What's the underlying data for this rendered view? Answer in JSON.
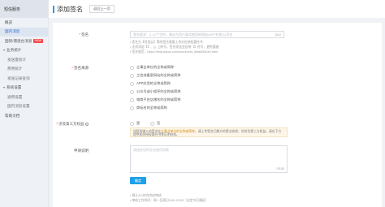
{
  "sidebar": {
    "brand": "短信服务",
    "items": [
      {
        "label": "概览",
        "type": "item"
      },
      {
        "label": "国内消息",
        "type": "item",
        "active": true
      },
      {
        "label": "国际/港澳台消息",
        "type": "item",
        "badge": "NEW"
      },
      {
        "label": "业务统计",
        "type": "group"
      },
      {
        "label": "发送量统计",
        "type": "sub"
      },
      {
        "label": "费用统计",
        "type": "sub"
      },
      {
        "label": "发送记录查询",
        "type": "sub"
      },
      {
        "label": "系统设置",
        "type": "group"
      },
      {
        "label": "通用设置",
        "type": "sub"
      },
      {
        "label": "国内消息设置",
        "type": "sub"
      },
      {
        "label": "帮助文档",
        "type": "item"
      }
    ]
  },
  "header": {
    "title": "添加签名",
    "back_label": "返回上一页"
  },
  "form": {
    "signature": {
      "label": "签名",
      "placeholder": "签名要求：2-12个字符，建议为用户真实使用的网站/APP名称/公司名",
      "counter": "0/12"
    },
    "signature_hints": [
      "• 签名为【阿里云】等的签名需要上传对应授权委托书",
      "• 无须添加【】、()、[]符号，签名发送会自带【】符号，避免重复",
      "• 签名规范：https://help.aliyun.com/document_detail/55040.html"
    ],
    "source": {
      "label": "签名来源",
      "options": [
        "企事业单位的全称或简称",
        "工信部备案网站的全称或简称",
        "APP应用的全称或简称",
        "公众号或小程序的全称或简称",
        "电商平台店铺名的全称或简称",
        "商标名的全称或简称"
      ]
    },
    "third_party": {
      "label": "涉及第三方权益",
      "options": [
        "是",
        "否"
      ]
    },
    "notice": {
      "text_1": "如您所输入的签名在",
      "highlight": "企事业单位的全称或简称",
      "text_2": "，请上传签名归属方的营业执照；如涉及第三方权益，请在下方提供",
      "text_3": "相关授权委托书等证明材料。"
    },
    "application": {
      "label": "申请说明",
      "placeholder": "请描述您的业务使用场景",
      "counter": "0/100"
    },
    "submit_label": "确定",
    "footer_notes": [
      "• 预计2小时内完成审核",
      "• 审核工作时间：周一至周日9:00-23:00（法定节日顺延）"
    ]
  },
  "colors": {
    "accent": "#1ea0e8",
    "required": "#f04848",
    "sidebar_bg": "#eef1f6"
  }
}
